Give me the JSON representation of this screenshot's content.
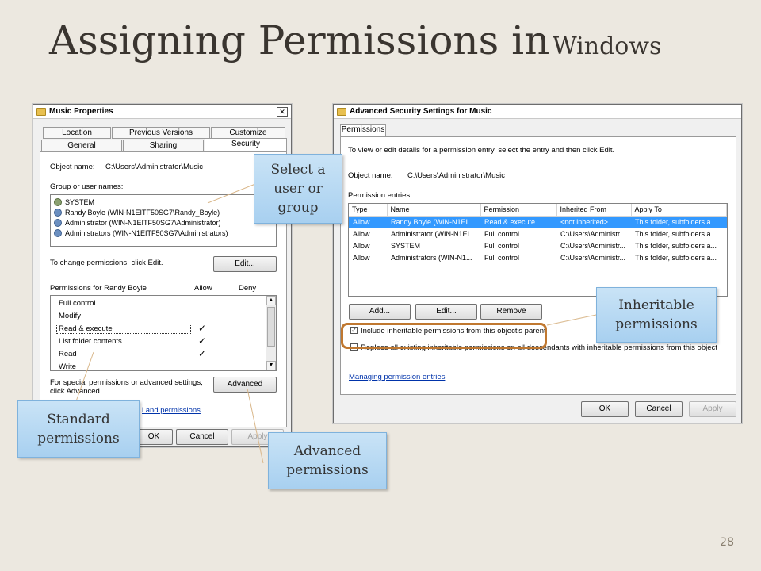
{
  "slide": {
    "title_main": "Assigning Permissions in",
    "title_sub": "Windows",
    "page_number": "28"
  },
  "props": {
    "title": "Music Properties",
    "close": "✕",
    "tabs_row1": [
      "Location",
      "Previous Versions",
      "Customize"
    ],
    "tabs_row2": [
      "General",
      "Sharing",
      "Security"
    ],
    "object_name_label": "Object name:",
    "object_name_value": "C:\\Users\\Administrator\\Music",
    "group_label": "Group or user names:",
    "users": [
      "SYSTEM",
      "Randy Boyle (WIN-N1EITF50SG7\\Randy_Boyle)",
      "Administrator (WIN-N1EITF50SG7\\Administrator)",
      "Administrators (WIN-N1EITF50SG7\\Administrators)"
    ],
    "change_text": "To change permissions, click Edit.",
    "edit_btn": "Edit...",
    "perm_for": "Permissions for Randy Boyle",
    "col_allow": "Allow",
    "col_deny": "Deny",
    "perms": [
      {
        "name": "Full control",
        "allow": ""
      },
      {
        "name": "Modify",
        "allow": ""
      },
      {
        "name": "Read & execute",
        "allow": "✓"
      },
      {
        "name": "List folder contents",
        "allow": "✓"
      },
      {
        "name": "Read",
        "allow": "✓"
      },
      {
        "name": "Write",
        "allow": ""
      }
    ],
    "special_text_1": "For special permissions or advanced settings,",
    "special_text_2": "click Advanced.",
    "advanced_btn": "Advanced",
    "learn_link": "l and permissions",
    "ok_btn": "OK",
    "cancel_btn": "Cancel",
    "apply_btn": "Apply"
  },
  "adv": {
    "title": "Advanced Security Settings for Music",
    "tab": "Permissions",
    "intro": "To view or edit details for a permission entry, select the entry and then click Edit.",
    "object_name_label": "Object name:",
    "object_name_value": "C:\\Users\\Administrator\\Music",
    "entries_label": "Permission entries:",
    "columns": [
      "Type",
      "Name",
      "Permission",
      "Inherited From",
      "Apply To"
    ],
    "rows": [
      [
        "Allow",
        "Randy Boyle (WIN-N1EI...",
        "Read & execute",
        "<not inherited>",
        "This folder, subfolders a..."
      ],
      [
        "Allow",
        "Administrator (WIN-N1EI...",
        "Full control",
        "C:\\Users\\Administr...",
        "This folder, subfolders a..."
      ],
      [
        "Allow",
        "SYSTEM",
        "Full control",
        "C:\\Users\\Administr...",
        "This folder, subfolders a..."
      ],
      [
        "Allow",
        "Administrators (WIN-N1...",
        "Full control",
        "C:\\Users\\Administr...",
        "This folder, subfolders a..."
      ]
    ],
    "add_btn": "Add...",
    "edit_btn": "Edit...",
    "remove_btn": "Remove",
    "include_inherit": "Include inheritable permissions from this object's parent",
    "replace_all": "Replace all existing inheritable permissions on all descendants with inheritable permissions from this object",
    "manage_link": "Managing permission entries",
    "ok_btn": "OK",
    "cancel_btn": "Cancel",
    "apply_btn": "Apply"
  },
  "callouts": {
    "select_user": "Select a user or group",
    "inheritable": "Inheritable permissions",
    "standard": "Standard permissions",
    "advanced": "Advanced permissions"
  },
  "colors": {
    "background": "#ece8e0",
    "callout": "#b8daf3",
    "highlight": "#c07830",
    "selection": "#3399ff"
  }
}
